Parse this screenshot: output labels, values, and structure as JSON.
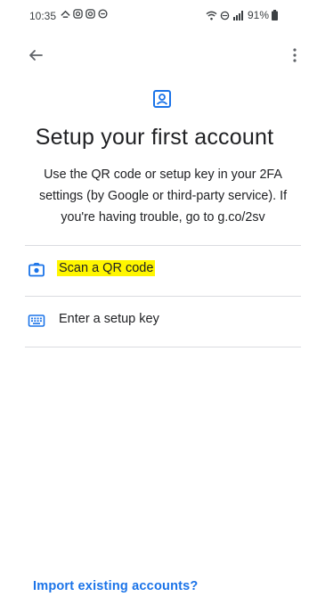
{
  "status_bar": {
    "time": "10:35",
    "battery": "91%"
  },
  "page": {
    "title": "Setup your first account",
    "description": "Use the QR code or setup key in your 2FA settings (by Google or third-party service). If you're having trouble, go to g.co/2sv"
  },
  "options": [
    {
      "label": "Scan a QR code",
      "icon": "camera-icon",
      "highlighted": true
    },
    {
      "label": "Enter a setup key",
      "icon": "keyboard-icon",
      "highlighted": false
    }
  ],
  "footer": {
    "import_label": "Import existing accounts?"
  },
  "colors": {
    "accent": "#1a73e8",
    "highlight": "#fff600",
    "divider": "#dadce0",
    "text": "#202124"
  }
}
